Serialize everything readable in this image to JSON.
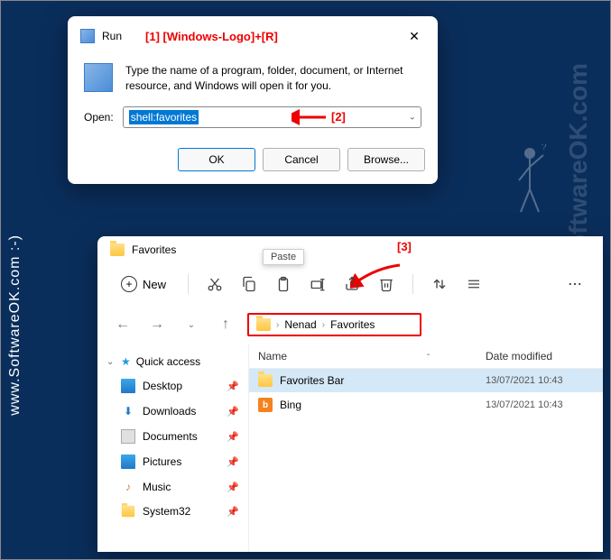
{
  "watermarks": {
    "left": "www.SoftwareOK.com :-)",
    "right": "SoftwareOK.com"
  },
  "annotations": {
    "a1": "[1]   [Windows-Logo]+[R]",
    "a2": "[2]",
    "a3": "[3]"
  },
  "run": {
    "title": "Run",
    "message": "Type the name of a program, folder, document, or Internet resource, and Windows will open it for you.",
    "open_label": "Open:",
    "input_value": "shell:favorites",
    "ok": "OK",
    "cancel": "Cancel",
    "browse": "Browse..."
  },
  "explorer": {
    "title": "Favorites",
    "toolbar": {
      "new_label": "New",
      "paste_tooltip": "Paste"
    },
    "breadcrumb": {
      "p1": "Nenad",
      "p2": "Favorites"
    },
    "sidebar": {
      "quick_access": "Quick access",
      "items": [
        {
          "label": "Desktop"
        },
        {
          "label": "Downloads"
        },
        {
          "label": "Documents"
        },
        {
          "label": "Pictures"
        },
        {
          "label": "Music"
        },
        {
          "label": "System32"
        }
      ]
    },
    "columns": {
      "name": "Name",
      "date": "Date modified"
    },
    "rows": [
      {
        "name": "Favorites Bar",
        "date": "13/07/2021 10:43",
        "type": "folder"
      },
      {
        "name": "Bing",
        "date": "13/07/2021 10:43",
        "type": "bing"
      }
    ]
  }
}
